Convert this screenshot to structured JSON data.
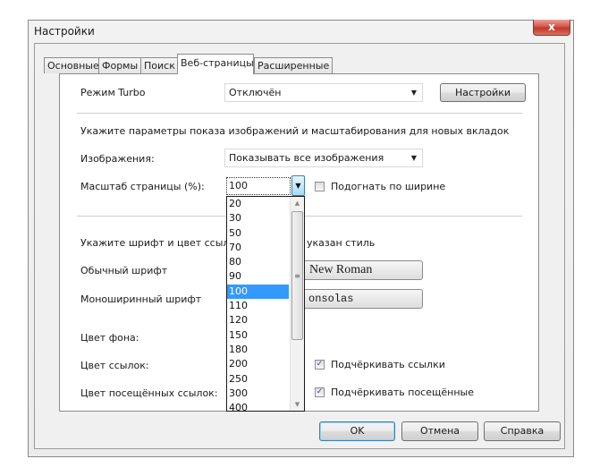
{
  "window": {
    "title": "Настройки",
    "close_label": "x"
  },
  "tabs": [
    {
      "label": "Основные",
      "active": false
    },
    {
      "label": "Формы",
      "active": false
    },
    {
      "label": "Поиск",
      "active": false
    },
    {
      "label": "Веб-страницы",
      "active": true
    },
    {
      "label": "Расширенные",
      "active": false
    }
  ],
  "turbo": {
    "label": "Режим Turbo",
    "value": "Отключён",
    "settings_button": "Настройки"
  },
  "images_section": {
    "heading": "Укажите параметры показа изображений и масштабирования для новых вкладок",
    "images_label": "Изображения:",
    "images_value": "Показывать все изображения",
    "zoom_label": "Масштаб страницы (%):",
    "zoom_value": "100",
    "fit_width_label": "Подогнать по ширине",
    "fit_width_checked": false,
    "zoom_options": [
      "20",
      "30",
      "50",
      "70",
      "80",
      "90",
      "100",
      "110",
      "120",
      "150",
      "180",
      "200",
      "250",
      "300",
      "400"
    ],
    "zoom_selected": "100"
  },
  "fonts_section": {
    "heading_left": "Укажите шрифт и цвет ссылок,",
    "heading_right": "указан стиль",
    "normal_font_label": "Обычный шрифт",
    "normal_font_value": "Times New Roman",
    "normal_font_visible": "New Roman",
    "mono_font_label": "Моноширинный шрифт",
    "mono_font_value": "Consolas",
    "mono_font_visible": "onsolas",
    "bg_color_label": "Цвет фона:",
    "link_color_label": "Цвет ссылок:",
    "underline_links_label": "Подчёркивать ссылки",
    "underline_links_checked": true,
    "visited_color_label": "Цвет посещённых ссылок:",
    "underline_visited_label": "Подчёркивать посещённые",
    "underline_visited_checked": true
  },
  "footer": {
    "ok": "OK",
    "cancel": "Отмена",
    "help": "Справка"
  }
}
